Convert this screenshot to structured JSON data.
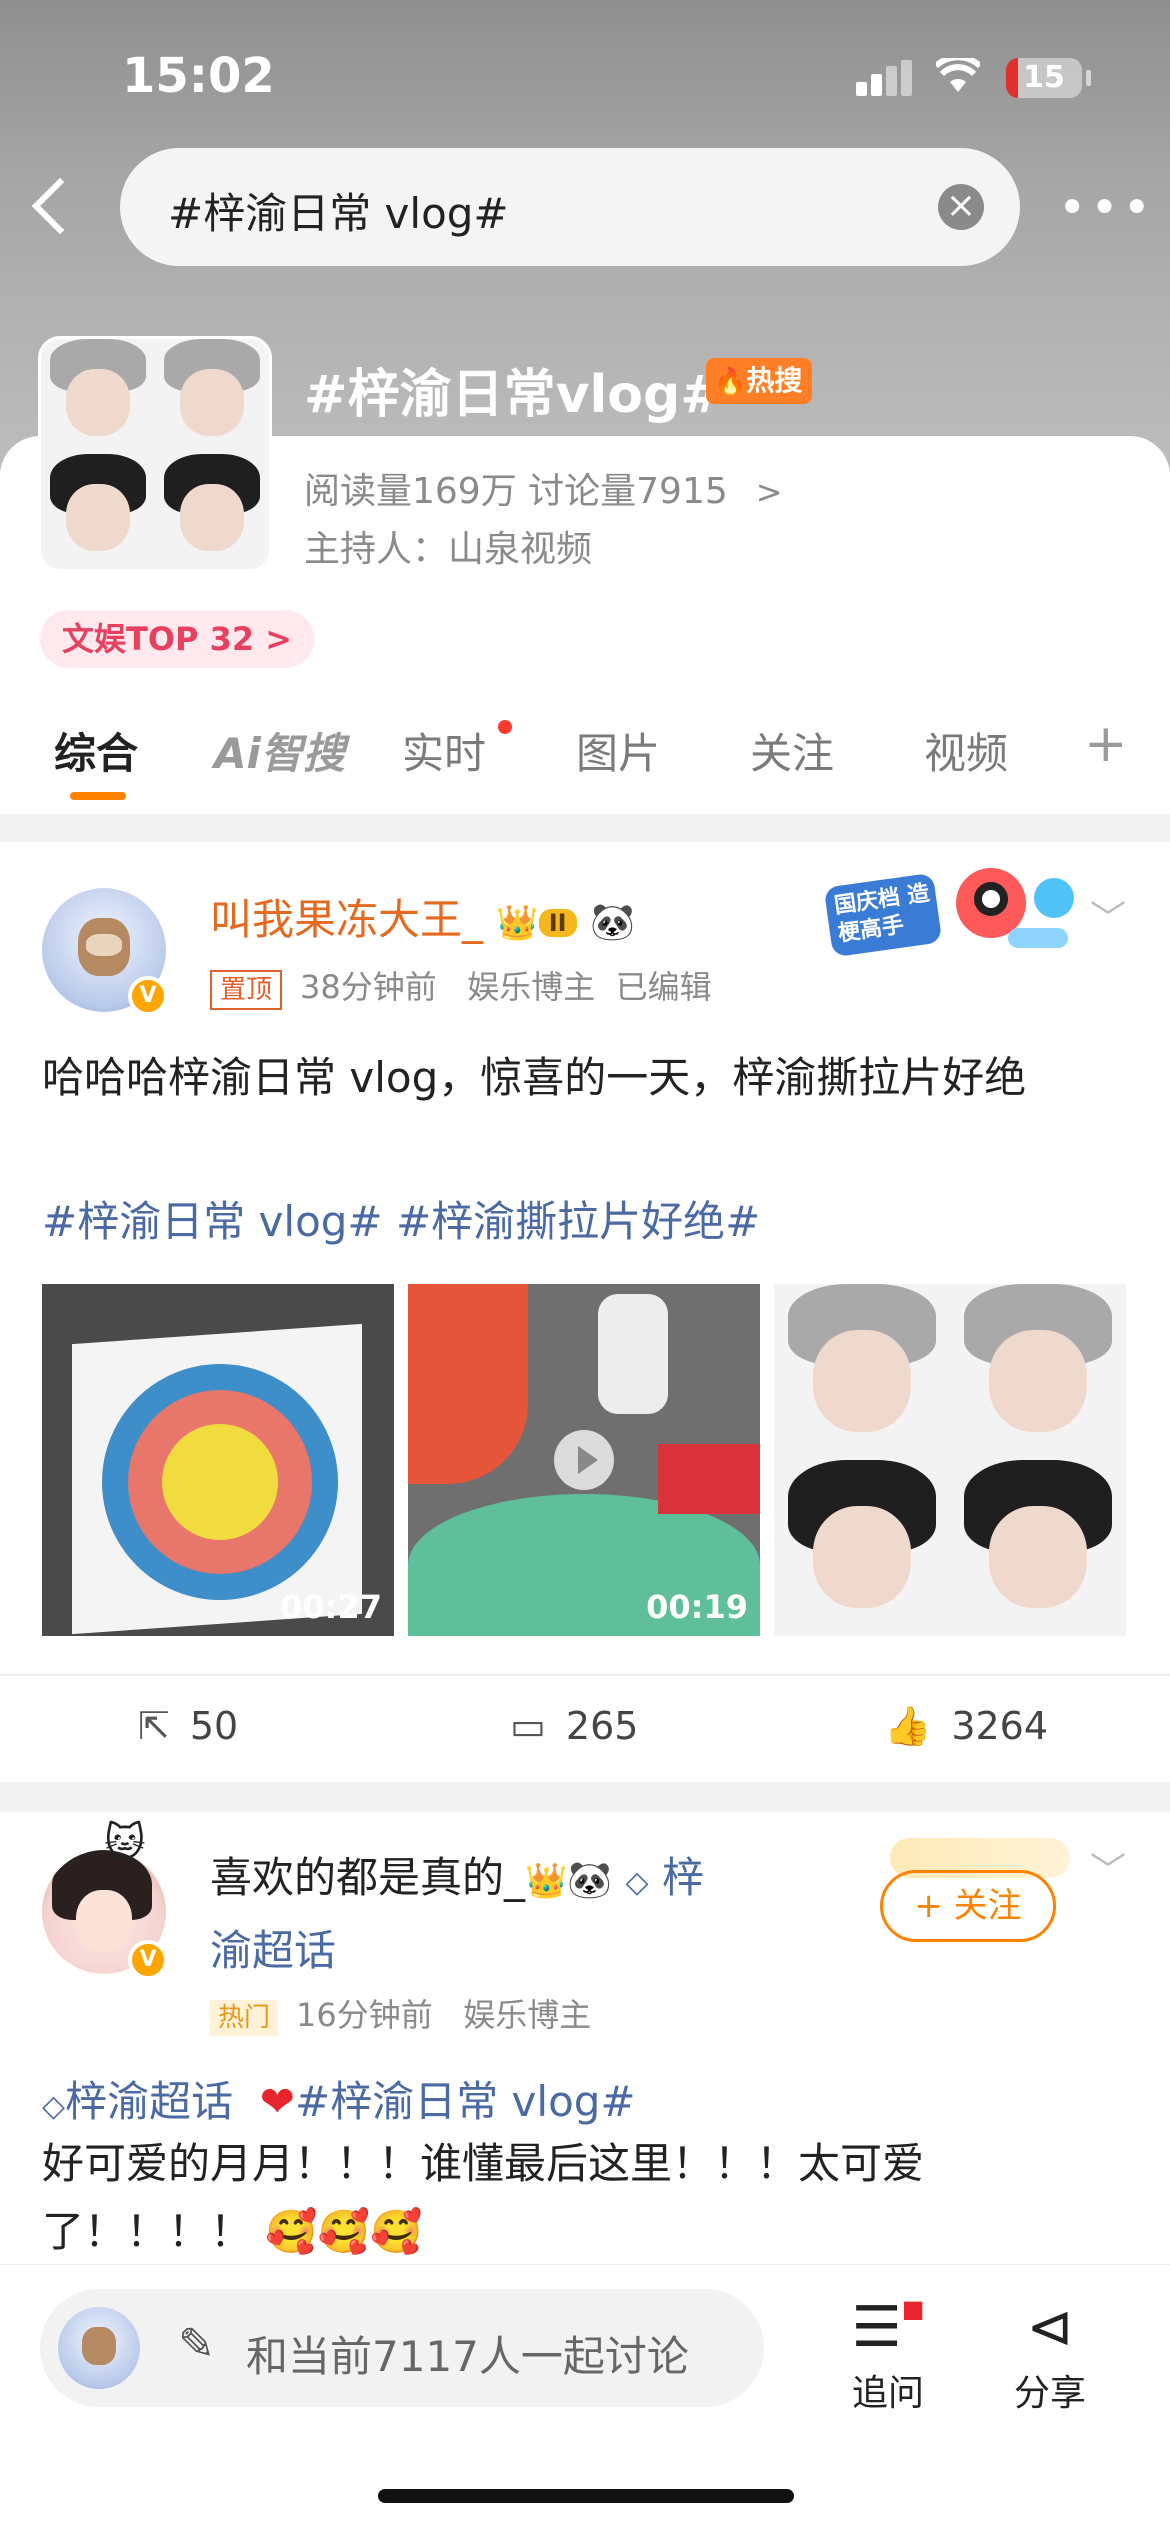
{
  "status_bar": {
    "time": "15:02",
    "battery": "15"
  },
  "search": {
    "query": "#梓渝日常 vlog#"
  },
  "topic": {
    "title": "#梓渝日常vlog#",
    "hot_badge": "热搜",
    "stats": "阅读量169万  讨论量7915",
    "host": "主持人：山泉视频",
    "rank": "文娱TOP 32 >"
  },
  "tabs": [
    "综合",
    "Ai智搜",
    "实时",
    "图片",
    "关注",
    "视频"
  ],
  "post1": {
    "author": "叫我果冻大王_",
    "level_badge": "II",
    "pinned": "置顶",
    "time": "38分钟前",
    "role": "娱乐博主",
    "edited": "已编辑",
    "promo": "国庆档 造梗高手",
    "text": "哈哈哈梓渝日常 vlog，惊喜的一天，梓渝撕拉片好绝",
    "topics": "#梓渝日常 vlog# #梓渝撕拉片好绝#",
    "media": [
      {
        "type": "video",
        "duration": "00:27"
      },
      {
        "type": "video",
        "duration": "00:19"
      },
      {
        "type": "image"
      }
    ],
    "reposts": "50",
    "comments": "265",
    "likes": "3264"
  },
  "post2": {
    "author": "喜欢的都是真的_",
    "supertopic_inline": "梓",
    "supertopic_inline_2": "渝超话",
    "hot": "热门",
    "time": "16分钟前",
    "role": "娱乐博主",
    "follow": "+ 关注",
    "topics_line": "梓渝超话",
    "topic_tag": "#梓渝日常 vlog#",
    "text": "好可爱的月月！！！谁懂最后这里！！！太可爱了！！！！"
  },
  "bottom_bar": {
    "placeholder": "和当前7117人一起讨论",
    "ask": "追问",
    "share": "分享"
  },
  "colors": {
    "accent": "#ff8200",
    "link": "#4b6aa3",
    "hot": "#ff7f27"
  }
}
